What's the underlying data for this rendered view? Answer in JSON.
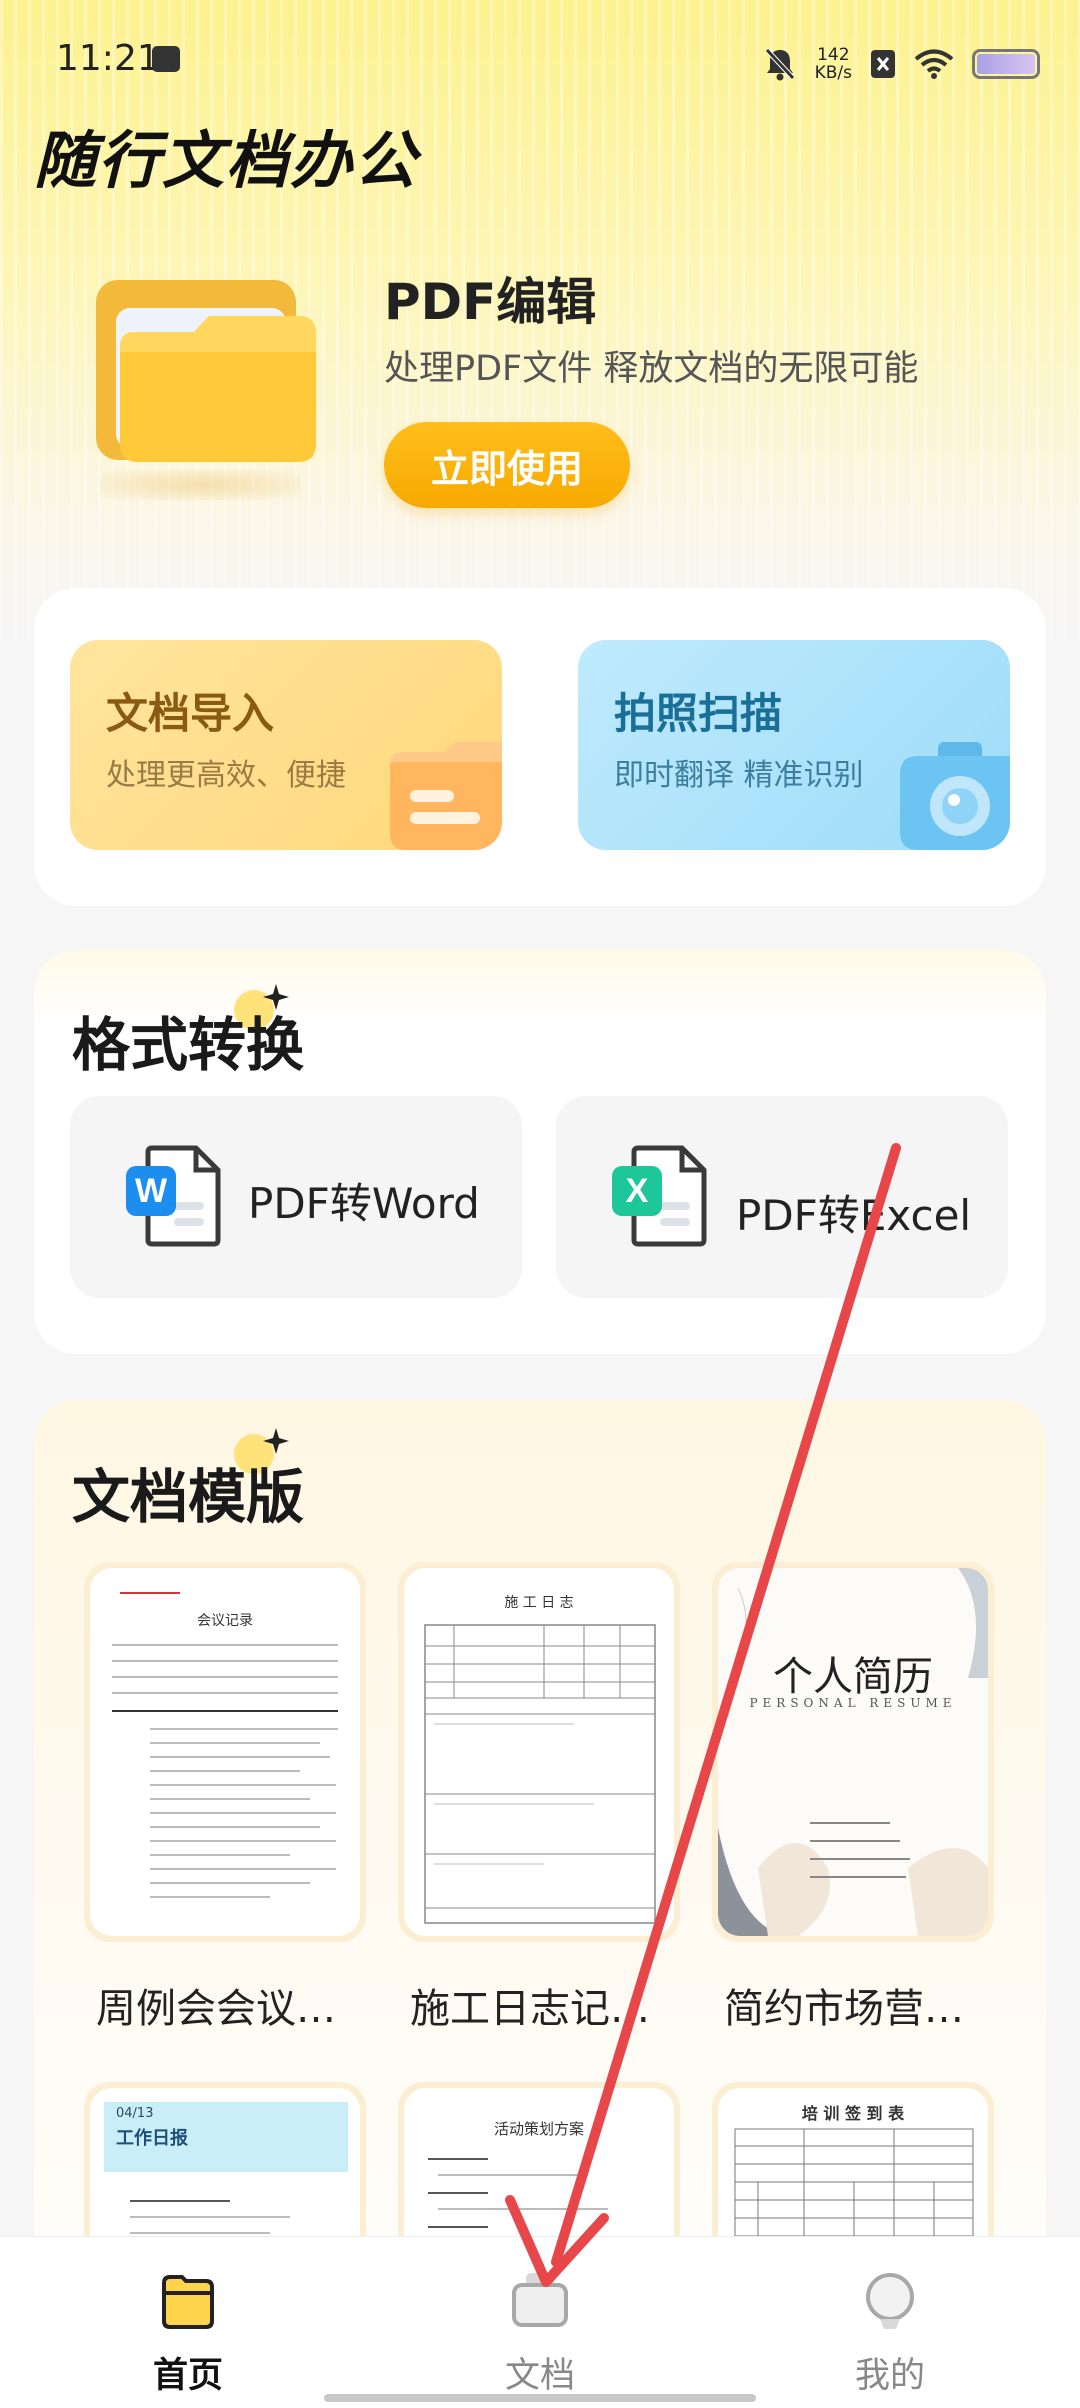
{
  "status_bar": {
    "time": "11:21",
    "speed_value": "142",
    "speed_unit": "KB/s"
  },
  "app": {
    "title": "随行文档办公"
  },
  "hero": {
    "title": "PDF编辑",
    "subtitle": "处理PDF文件 释放文档的无限可能",
    "button": "立即使用"
  },
  "quick_actions": [
    {
      "title": "文档导入",
      "subtitle": "处理更高效、便捷"
    },
    {
      "title": "拍照扫描",
      "subtitle": "即时翻译 精准识别"
    }
  ],
  "format_convert": {
    "title": "格式转换",
    "items": [
      {
        "label": "PDF转Word",
        "icon_letter": "W"
      },
      {
        "label": "PDF转Excel",
        "icon_letter": "X"
      }
    ]
  },
  "templates": {
    "title": "文档模版",
    "items": [
      {
        "name": "周例会会议…",
        "thumb_title": "会议记录"
      },
      {
        "name": "施工日志记…",
        "thumb_title": "施 工 日 志"
      },
      {
        "name": "简约市场营…",
        "thumb_title": "个人简历",
        "thumb_subtitle": "PERSONAL RESUME"
      },
      {
        "name": "",
        "thumb_title": "工作日报",
        "thumb_date": "04/13"
      },
      {
        "name": "",
        "thumb_title": "活动策划方案"
      },
      {
        "name": "",
        "thumb_title": "培 训 签 到 表"
      }
    ]
  },
  "nav": [
    {
      "label": "首页"
    },
    {
      "label": "文档"
    },
    {
      "label": "我的"
    }
  ],
  "colors": {
    "accent": "#f7a900",
    "annotation_arrow": "#e8474a"
  },
  "icons": [
    "folder-icon",
    "camera-icon",
    "word-icon",
    "excel-icon",
    "sparkle-icon"
  ]
}
